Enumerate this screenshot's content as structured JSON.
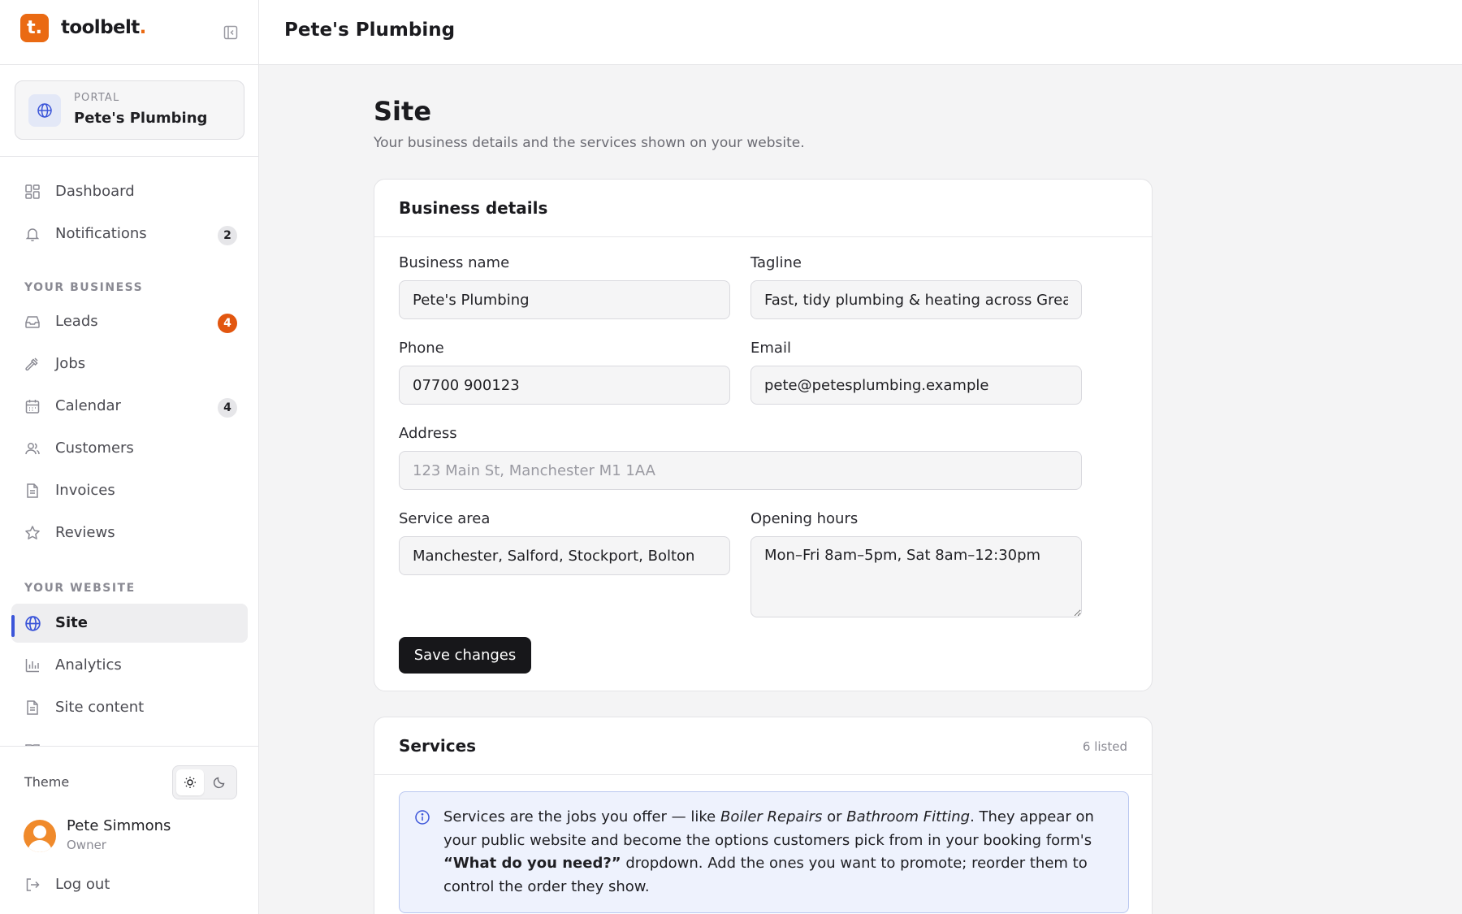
{
  "brand": {
    "logo_letter": "t.",
    "name": "toolbelt",
    "name_dot": "."
  },
  "portal": {
    "label": "PORTAL",
    "name": "Pete's Plumbing"
  },
  "nav": {
    "dashboard": "Dashboard",
    "notifications": "Notifications",
    "notifications_count": "2",
    "section_business": "YOUR BUSINESS",
    "leads": "Leads",
    "leads_count": "4",
    "jobs": "Jobs",
    "calendar": "Calendar",
    "calendar_count": "4",
    "customers": "Customers",
    "invoices": "Invoices",
    "reviews": "Reviews",
    "section_website": "YOUR WEBSITE",
    "site": "Site",
    "analytics": "Analytics",
    "site_content": "Site content"
  },
  "footer": {
    "theme_label": "Theme",
    "user_name": "Pete Simmons",
    "user_role": "Owner",
    "logout": "Log out"
  },
  "topbar": {
    "title": "Pete's Plumbing"
  },
  "page": {
    "title": "Site",
    "subtitle": "Your business details and the services shown on your website."
  },
  "business": {
    "title": "Business details",
    "name_label": "Business name",
    "name_value": "Pete's Plumbing",
    "tagline_label": "Tagline",
    "tagline_value": "Fast, tidy plumbing & heating across Greater Manchester",
    "phone_label": "Phone",
    "phone_value": "07700 900123",
    "email_label": "Email",
    "email_value": "pete@petesplumbing.example",
    "address_label": "Address",
    "address_placeholder": "123 Main St, Manchester M1 1AA",
    "service_area_label": "Service area",
    "service_area_value": "Manchester, Salford, Stockport, Bolton",
    "hours_label": "Opening hours",
    "hours_value": "Mon–Fri 8am–5pm, Sat 8am–12:30pm",
    "save_label": "Save changes"
  },
  "services": {
    "title": "Services",
    "count": "6 listed",
    "info_1": "Services are the jobs you offer — like ",
    "info_em1": "Boiler Repairs",
    "info_2": " or ",
    "info_em2": "Bathroom Fitting",
    "info_3": ". They appear on your public website and become the options customers pick from in your booking form's ",
    "info_strong": "“What do you need?”",
    "info_4": " dropdown. Add the ones you want to promote; reorder them to control the order they show."
  }
}
